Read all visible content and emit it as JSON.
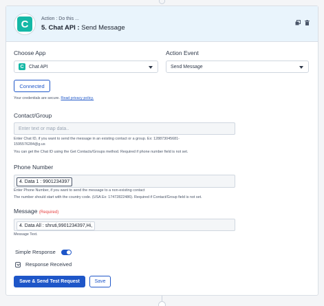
{
  "header": {
    "subtitle": "Action : Do this ...",
    "title_bold": "5. Chat API :",
    "title_rest": " Send Message"
  },
  "fields": {
    "choose_app": {
      "label": "Choose App",
      "value": "Chat API"
    },
    "action_event": {
      "label": "Action Event",
      "value": "Send Message"
    },
    "connected_label": "Connected",
    "secure_text": "Your credentials are secure.",
    "privacy_link": "Read privacy policy.",
    "contact_group": {
      "label": "Contact/Group",
      "placeholder": "Enter text or map data..",
      "help_1": "Enter Chat ID, if you want to send the message in an existing contact or a group. Ex: 128873045681-",
      "help_2": "1595576284@g.us",
      "help_3": "You can get the Chat ID using the Get Contacts/Groups method. Required if phone number field is not set."
    },
    "phone_number": {
      "label": "Phone Number",
      "value": "4. Data 1 : 9901234397",
      "help_1": "Enter Phone Number, if you want to send the message to a non-existing contact",
      "help_2": "The number should start with the country code. (USA Ex: 17472822486). Required if Contact/Group field is not set."
    },
    "message": {
      "label": "Message",
      "required": "(Required)",
      "value": "4. Data All : shruti,9901234397,Hi,",
      "help": "Message Text."
    },
    "simple_response": {
      "label": "Simple Response",
      "on": true
    },
    "response_received": {
      "label": "Response Received"
    }
  },
  "buttons": {
    "save_send": "Save & Send Test Request",
    "save": "Save"
  },
  "colors": {
    "accent": "#1e56c8",
    "header_bg": "#e9f4fc",
    "brand": "#14b8a6"
  }
}
